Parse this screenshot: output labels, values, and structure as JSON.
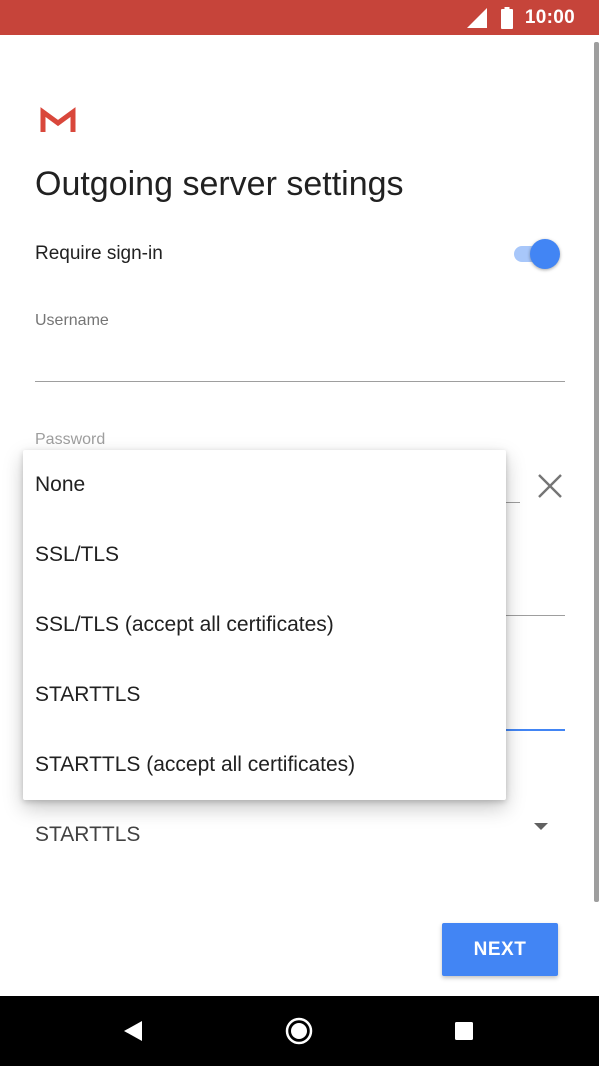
{
  "status_bar": {
    "time": "10:00",
    "icons": [
      "signal-icon",
      "battery-icon"
    ],
    "background": "#c6443a"
  },
  "app": {
    "logo_icon": "gmail-logo",
    "title": "Outgoing server settings"
  },
  "require_sign_in": {
    "label": "Require sign-in",
    "enabled": true,
    "accent": "#4285f4"
  },
  "username": {
    "label": "Username",
    "value": ""
  },
  "password": {
    "label": "Password",
    "clear_icon": "close-icon"
  },
  "security": {
    "selected": "STARTTLS",
    "options": [
      "None",
      "SSL/TLS",
      "SSL/TLS (accept all certificates)",
      "STARTTLS",
      "STARTTLS (accept all certificates)"
    ]
  },
  "actions": {
    "next_label": "NEXT",
    "color": "#4285f4"
  },
  "nav_bar": {
    "icons": [
      "back-icon",
      "home-icon",
      "recents-icon"
    ]
  }
}
